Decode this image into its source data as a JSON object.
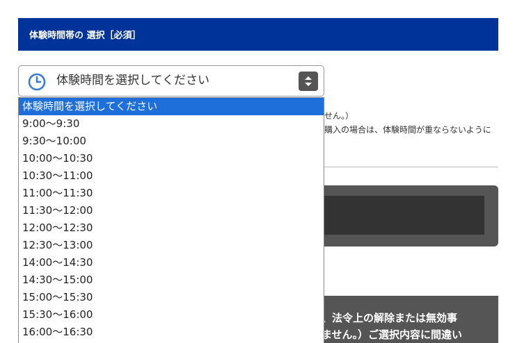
{
  "section": {
    "title": "体験時間帯の 選択［必須］"
  },
  "select": {
    "current_value": "体験時間を選択してください",
    "icon": "clock-icon",
    "arrow_icon": "updown-arrows-icon"
  },
  "background": {
    "line1": "せん。）",
    "line2": "購入の場合は、体験時間が重ならないように",
    "notice_line1": "、法令上の解除または無効事",
    "notice_line2": "ません。）ご選択内容に間違い"
  },
  "dropdown": {
    "options": [
      "体験時間を選択してください",
      "9:00～9:30",
      "9:30～10:00",
      "10:00～10:30",
      "10:30～11:00",
      "11:00～11:30",
      "11:30～12:00",
      "12:00～12:30",
      "12:30～13:00",
      "14:00～14:30",
      "14:30～15:00",
      "15:00～15:30",
      "15:30～16:00",
      "16:00～16:30"
    ],
    "selected_index": 0
  },
  "colors": {
    "header_bg": "#003399",
    "selected_option_bg": "#1e6fd9",
    "clock_icon": "#3a7bd5"
  }
}
